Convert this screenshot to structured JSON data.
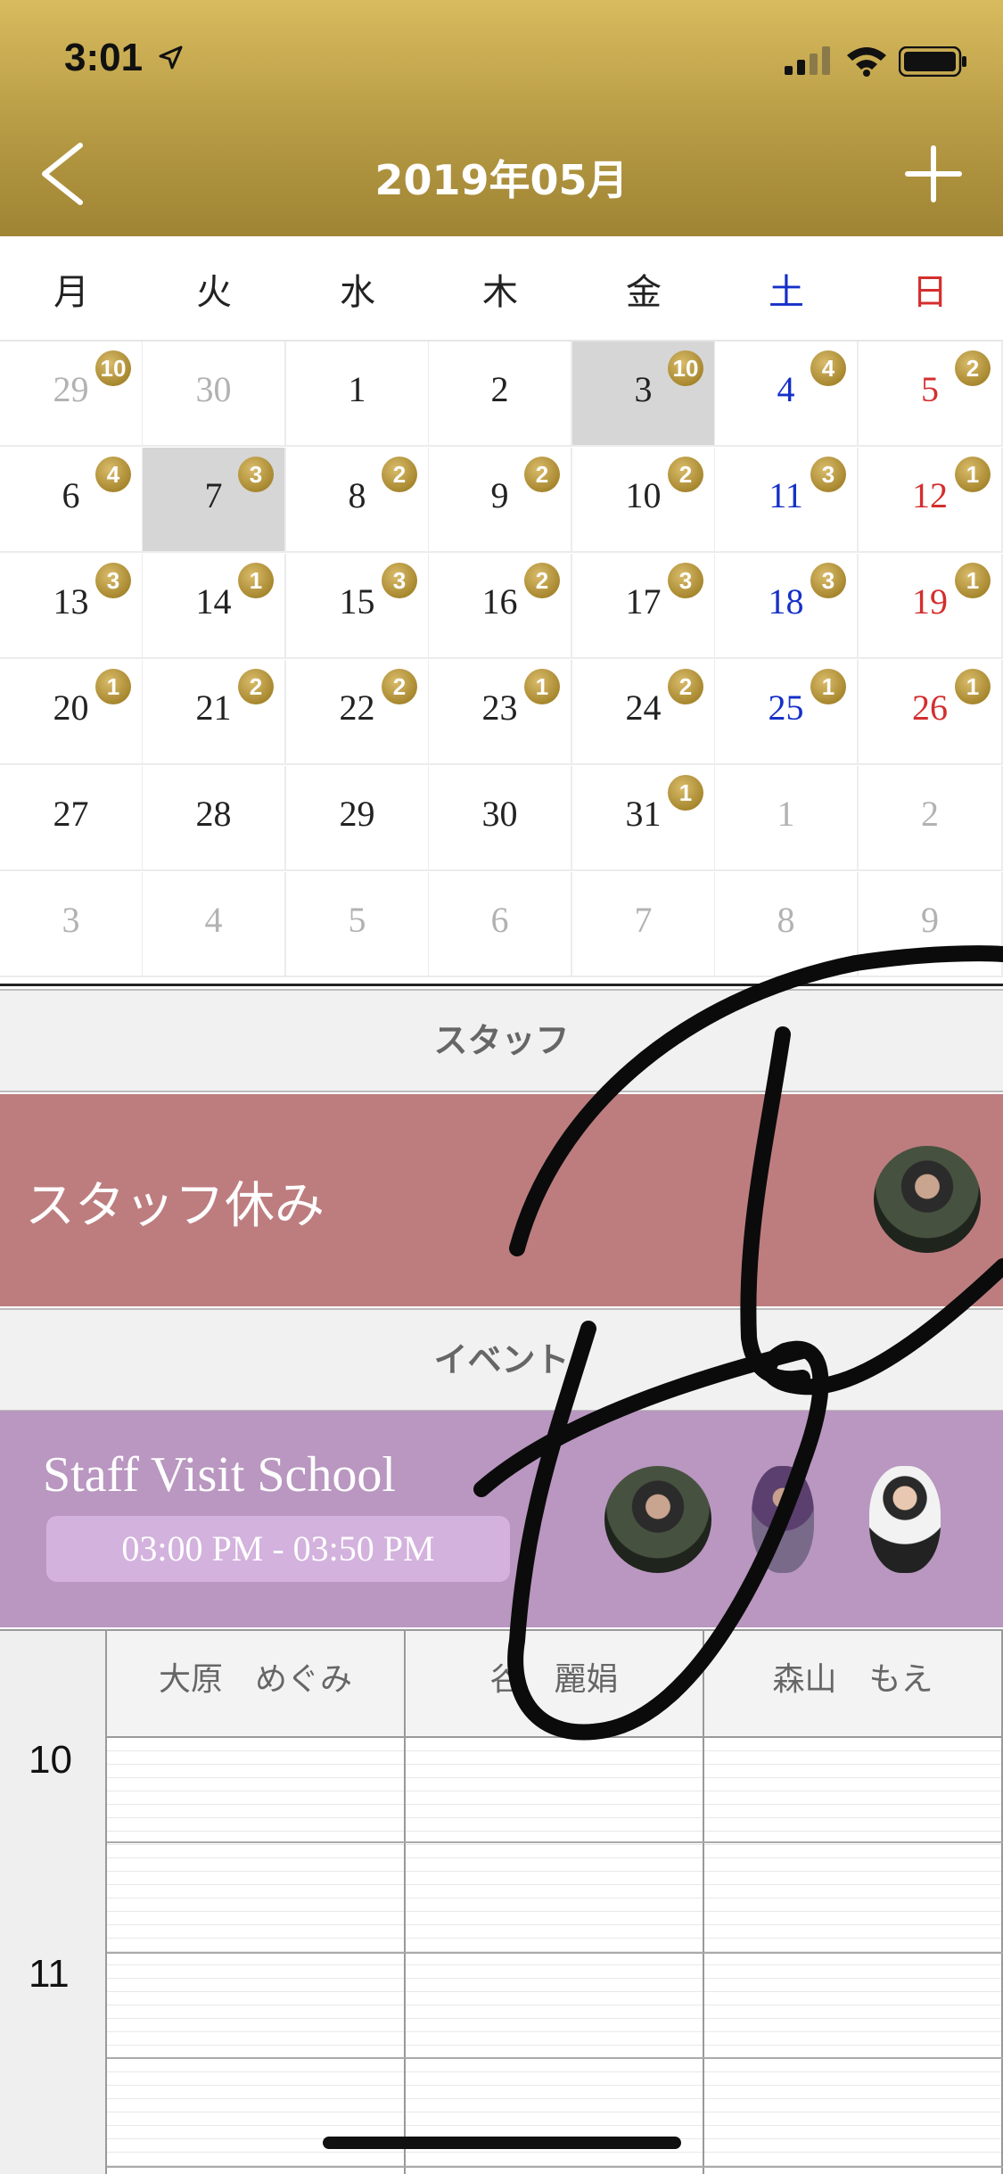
{
  "status_bar": {
    "time": "3:01"
  },
  "header": {
    "title": "2019年05月"
  },
  "calendar": {
    "weekdays": [
      "月",
      "火",
      "水",
      "木",
      "金",
      "土",
      "日"
    ],
    "weeks": [
      [
        {
          "d": "29",
          "badge": "10",
          "other": true
        },
        {
          "d": "30",
          "other": true
        },
        {
          "d": "1"
        },
        {
          "d": "2"
        },
        {
          "d": "3",
          "badge": "10",
          "selected": true
        },
        {
          "d": "4",
          "badge": "4"
        },
        {
          "d": "5",
          "badge": "2"
        }
      ],
      [
        {
          "d": "6",
          "badge": "4"
        },
        {
          "d": "7",
          "badge": "3",
          "selected": true
        },
        {
          "d": "8",
          "badge": "2"
        },
        {
          "d": "9",
          "badge": "2"
        },
        {
          "d": "10",
          "badge": "2"
        },
        {
          "d": "11",
          "badge": "3"
        },
        {
          "d": "12",
          "badge": "1"
        }
      ],
      [
        {
          "d": "13",
          "badge": "3"
        },
        {
          "d": "14",
          "badge": "1"
        },
        {
          "d": "15",
          "badge": "3"
        },
        {
          "d": "16",
          "badge": "2"
        },
        {
          "d": "17",
          "badge": "3"
        },
        {
          "d": "18",
          "badge": "3"
        },
        {
          "d": "19",
          "badge": "1"
        }
      ],
      [
        {
          "d": "20",
          "badge": "1"
        },
        {
          "d": "21",
          "badge": "2"
        },
        {
          "d": "22",
          "badge": "2"
        },
        {
          "d": "23",
          "badge": "1"
        },
        {
          "d": "24",
          "badge": "2"
        },
        {
          "d": "25",
          "badge": "1"
        },
        {
          "d": "26",
          "badge": "1"
        }
      ],
      [
        {
          "d": "27"
        },
        {
          "d": "28"
        },
        {
          "d": "29"
        },
        {
          "d": "30"
        },
        {
          "d": "31",
          "badge": "1"
        },
        {
          "d": "1",
          "other": true
        },
        {
          "d": "2",
          "other": true
        }
      ],
      [
        {
          "d": "3",
          "other": true
        },
        {
          "d": "4",
          "other": true
        },
        {
          "d": "5",
          "other": true
        },
        {
          "d": "6",
          "other": true
        },
        {
          "d": "7",
          "other": true
        },
        {
          "d": "8",
          "other": true
        },
        {
          "d": "9",
          "other": true
        }
      ]
    ]
  },
  "staff_section": {
    "heading": "スタッフ",
    "item_label": "スタッフ休み"
  },
  "event_section": {
    "heading": "イベント",
    "event_title": "Staff Visit School",
    "event_time": "03:00 PM - 03:50 PM"
  },
  "schedule": {
    "staff": [
      "大原　めぐみ",
      "谷　麗娟",
      "森山　もえ"
    ],
    "hours": [
      "10",
      "11"
    ]
  },
  "colors": {
    "header_gold": "#b69a44",
    "saturday_blue": "#1530c8",
    "sunday_red": "#d42e2e",
    "staff_off_bg": "#bd7d7f",
    "event_bg": "#b997c0"
  }
}
